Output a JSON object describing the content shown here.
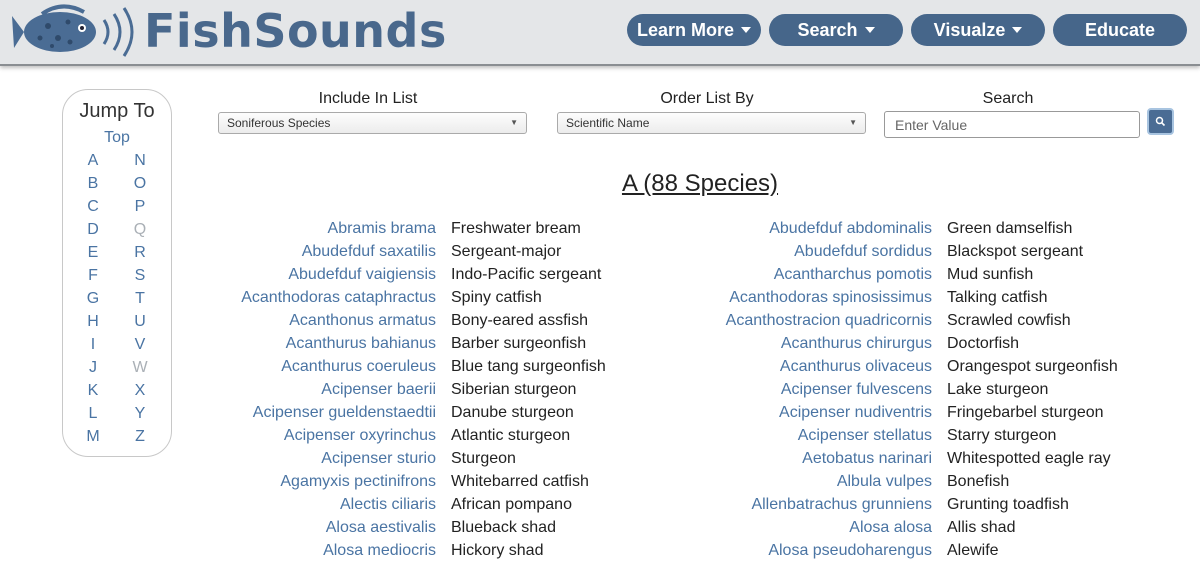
{
  "header": {
    "logo_text": "FishSounds",
    "nav": [
      {
        "label": "Learn More",
        "dropdown": true
      },
      {
        "label": "Search",
        "dropdown": true
      },
      {
        "label": "Visualze",
        "dropdown": true
      },
      {
        "label": "Educate",
        "dropdown": false
      }
    ]
  },
  "jump": {
    "title": "Jump To",
    "top": "Top",
    "left_letters": [
      "A",
      "B",
      "C",
      "D",
      "E",
      "F",
      "G",
      "H",
      "I",
      "J",
      "K",
      "L",
      "M"
    ],
    "right_letters": [
      "N",
      "O",
      "P",
      "Q",
      "R",
      "S",
      "T",
      "U",
      "V",
      "W",
      "X",
      "Y",
      "Z"
    ],
    "disabled_letters": [
      "Q",
      "W"
    ]
  },
  "controls": {
    "include_label": "Include In List",
    "include_value": "Soniferous Species",
    "order_label": "Order List By",
    "order_value": "Scientific Name",
    "search_label": "Search",
    "search_placeholder": "Enter Value"
  },
  "section": {
    "heading": "A (88 Species)"
  },
  "species_left": [
    {
      "sci": "Abramis brama",
      "common": "Freshwater bream"
    },
    {
      "sci": "Abudefduf saxatilis",
      "common": "Sergeant-major"
    },
    {
      "sci": "Abudefduf vaigiensis",
      "common": "Indo-Pacific sergeant"
    },
    {
      "sci": "Acanthodoras cataphractus",
      "common": "Spiny catfish"
    },
    {
      "sci": "Acanthonus armatus",
      "common": "Bony-eared assfish"
    },
    {
      "sci": "Acanthurus bahianus",
      "common": "Barber surgeonfish"
    },
    {
      "sci": "Acanthurus coeruleus",
      "common": "Blue tang surgeonfish"
    },
    {
      "sci": "Acipenser baerii",
      "common": "Siberian sturgeon"
    },
    {
      "sci": "Acipenser gueldenstaedtii",
      "common": "Danube sturgeon"
    },
    {
      "sci": "Acipenser oxyrinchus",
      "common": "Atlantic sturgeon"
    },
    {
      "sci": "Acipenser sturio",
      "common": "Sturgeon"
    },
    {
      "sci": "Agamyxis pectinifrons",
      "common": "Whitebarred catfish"
    },
    {
      "sci": "Alectis ciliaris",
      "common": "African pompano"
    },
    {
      "sci": "Alosa aestivalis",
      "common": "Blueback shad"
    },
    {
      "sci": "Alosa mediocris",
      "common": "Hickory shad"
    }
  ],
  "species_right": [
    {
      "sci": "Abudefduf abdominalis",
      "common": "Green damselfish"
    },
    {
      "sci": "Abudefduf sordidus",
      "common": "Blackspot sergeant"
    },
    {
      "sci": "Acantharchus pomotis",
      "common": "Mud sunfish"
    },
    {
      "sci": "Acanthodoras spinosissimus",
      "common": "Talking catfish"
    },
    {
      "sci": "Acanthostracion quadricornis",
      "common": "Scrawled cowfish"
    },
    {
      "sci": "Acanthurus chirurgus",
      "common": "Doctorfish"
    },
    {
      "sci": "Acanthurus olivaceus",
      "common": "Orangespot surgeonfish"
    },
    {
      "sci": "Acipenser fulvescens",
      "common": "Lake sturgeon"
    },
    {
      "sci": "Acipenser nudiventris",
      "common": "Fringebarbel sturgeon"
    },
    {
      "sci": "Acipenser stellatus",
      "common": "Starry sturgeon"
    },
    {
      "sci": "Aetobatus narinari",
      "common": "Whitespotted eagle ray"
    },
    {
      "sci": "Albula vulpes",
      "common": "Bonefish"
    },
    {
      "sci": "Allenbatrachus grunniens",
      "common": "Grunting toadfish"
    },
    {
      "sci": "Alosa alosa",
      "common": "Allis shad"
    },
    {
      "sci": "Alosa pseudoharengus",
      "common": "Alewife"
    }
  ],
  "colors": {
    "brand": "#49688c",
    "nav": "#46668a",
    "link": "#4a74a3"
  },
  "icons": {
    "logo": "fish-logo-icon",
    "search": "search-icon"
  }
}
